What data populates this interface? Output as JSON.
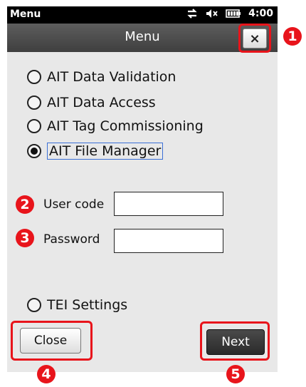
{
  "statusbar": {
    "app_name": "Menu",
    "time": "4:00",
    "icons": [
      "network-sync-icon",
      "volume-muted-icon",
      "battery-icon"
    ]
  },
  "titlebar": {
    "title": "Menu",
    "close_glyph": "×"
  },
  "options": [
    {
      "label": "AIT Data Validation",
      "selected": false
    },
    {
      "label": "AIT Data Access",
      "selected": false
    },
    {
      "label": "AIT Tag Commissioning",
      "selected": false
    },
    {
      "label": "AIT File Manager",
      "selected": true
    }
  ],
  "login": {
    "user_code_label": "User code",
    "user_code_value": "",
    "password_label": "Password",
    "password_value": ""
  },
  "settings_option": {
    "label": "TEI Settings",
    "selected": false
  },
  "buttons": {
    "close_label": "Close",
    "next_label": "Next"
  },
  "callouts": {
    "1": "1",
    "2": "2",
    "3": "3",
    "4": "4",
    "5": "5"
  },
  "colors": {
    "callout": "#e8141b",
    "titlebar": "#4a4a4a",
    "background": "#e8e8e8"
  }
}
